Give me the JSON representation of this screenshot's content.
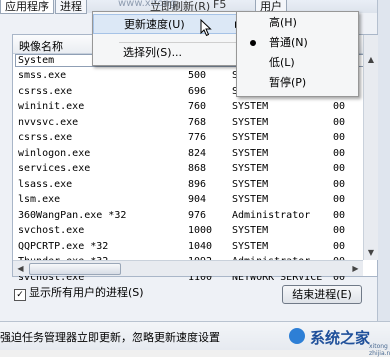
{
  "tabs": [
    {
      "label": "应用程序"
    },
    {
      "label": "进程"
    },
    {
      "label": "用户"
    }
  ],
  "menu_bar_fragments": {
    "update_now": "立即刷新(R)",
    "update_key": "F5",
    "watermark": "www.xitong"
  },
  "menu": {
    "update_speed": "更新速度(U)",
    "select_columns": "选择列(S)..."
  },
  "submenu": {
    "items": [
      {
        "label": "高(H)"
      },
      {
        "label": "普通(N)",
        "selected": true
      },
      {
        "label": "低(L)"
      },
      {
        "label": "暂停(P)"
      }
    ]
  },
  "table": {
    "columns": {
      "name": "映像名称"
    },
    "filter_value": "System",
    "rows": [
      {
        "name": "smss.exe",
        "pid": "500",
        "user": "SYSTEM",
        "cpu": "00"
      },
      {
        "name": "csrss.exe",
        "pid": "696",
        "user": "SYSTEM",
        "cpu": "00"
      },
      {
        "name": "wininit.exe",
        "pid": "760",
        "user": "SYSTEM",
        "cpu": "00"
      },
      {
        "name": "nvvsvc.exe",
        "pid": "768",
        "user": "SYSTEM",
        "cpu": "00"
      },
      {
        "name": "csrss.exe",
        "pid": "776",
        "user": "SYSTEM",
        "cpu": "00"
      },
      {
        "name": "winlogon.exe",
        "pid": "824",
        "user": "SYSTEM",
        "cpu": "00"
      },
      {
        "name": "services.exe",
        "pid": "868",
        "user": "SYSTEM",
        "cpu": "00"
      },
      {
        "name": "lsass.exe",
        "pid": "896",
        "user": "SYSTEM",
        "cpu": "00"
      },
      {
        "name": "lsm.exe",
        "pid": "904",
        "user": "SYSTEM",
        "cpu": "00"
      },
      {
        "name": "360WangPan.exe *32",
        "pid": "976",
        "user": "Administrator",
        "cpu": "00"
      },
      {
        "name": "svchost.exe",
        "pid": "1000",
        "user": "SYSTEM",
        "cpu": "00"
      },
      {
        "name": "QQPCRTP.exe *32",
        "pid": "1040",
        "user": "SYSTEM",
        "cpu": "00"
      },
      {
        "name": "Thunder.exe *32",
        "pid": "1092",
        "user": "Administrator",
        "cpu": "00"
      },
      {
        "name": "svchost.exe",
        "pid": "1100",
        "user": "NETWORK SERVICE",
        "cpu": "00"
      }
    ]
  },
  "show_all_users": {
    "label": "显示所有用户的进程(S)",
    "checked": true
  },
  "end_process_button": "结束进程(E)",
  "status_text": "强迫任务管理器立即更新，忽略更新速度设置",
  "logo": {
    "text": "系统之家",
    "sub": "xitong zhijia.net"
  },
  "colors": {
    "menu_highlight": "#dce8f6",
    "logo_blue": "#1e4f9a"
  }
}
